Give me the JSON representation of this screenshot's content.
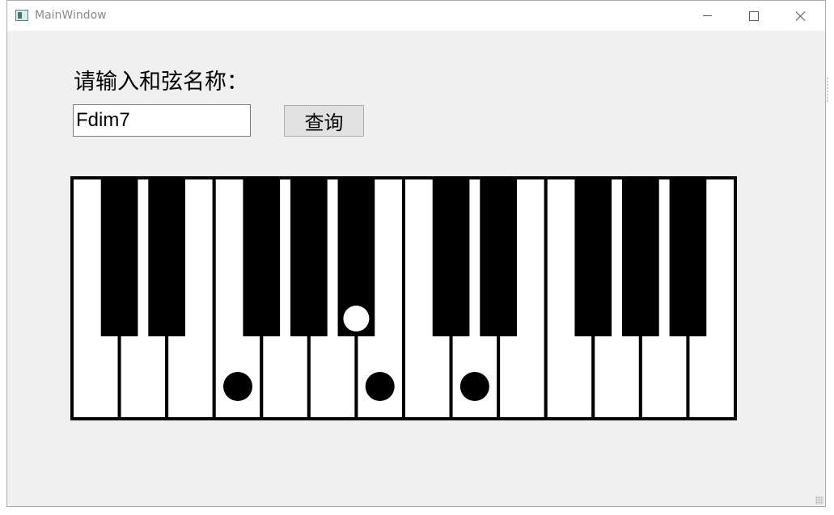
{
  "window": {
    "title": "MainWindow",
    "icons": {
      "app": "app-window-icon",
      "minimize": "minimize-icon",
      "maximize": "maximize-icon",
      "close": "close-icon"
    }
  },
  "form": {
    "prompt_label": "请输入和弦名称：",
    "chord_value": "Fdim7",
    "chord_placeholder": "",
    "query_button_label": "查询"
  },
  "keyboard": {
    "white_key_count": 14,
    "black_keys_after_white_index": [
      0,
      1,
      3,
      4,
      5,
      7,
      8,
      10,
      11,
      12
    ],
    "highlighted_white_keys": [
      3,
      6,
      8
    ],
    "highlighted_black_keys": [
      4
    ],
    "colors": {
      "white_key": "#ffffff",
      "black_key": "#000000",
      "outline": "#000000",
      "marker_on_white": "#000000",
      "marker_on_black": "#ffffff"
    }
  }
}
